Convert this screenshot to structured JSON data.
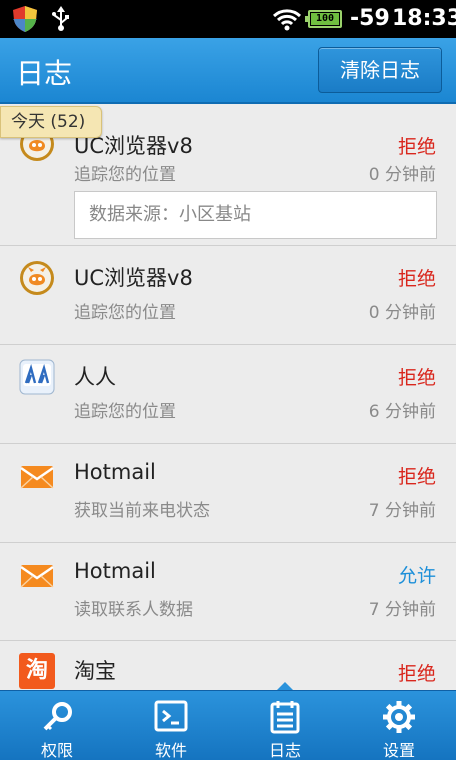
{
  "status_bar": {
    "signal": "-59",
    "time": "18:33",
    "battery_label": "100"
  },
  "header": {
    "title": "日志",
    "clear_button": "清除日志"
  },
  "day_group": {
    "label": "今天 (52)"
  },
  "entries": [
    {
      "app": "UC浏览器v8",
      "icon": "uc-browser-icon",
      "action": "拒绝",
      "action_type": "deny",
      "permission": "追踪您的位置",
      "time_ago": "0 分钟前",
      "detail": "数据来源：小区基站"
    },
    {
      "app": "UC浏览器v8",
      "icon": "uc-browser-icon",
      "action": "拒绝",
      "action_type": "deny",
      "permission": "追踪您的位置",
      "time_ago": "0 分钟前"
    },
    {
      "app": "人人",
      "icon": "renren-icon",
      "action": "拒绝",
      "action_type": "deny",
      "permission": "追踪您的位置",
      "time_ago": "6 分钟前"
    },
    {
      "app": "Hotmail",
      "icon": "hotmail-icon",
      "action": "拒绝",
      "action_type": "deny",
      "permission": "获取当前来电状态",
      "time_ago": "7 分钟前"
    },
    {
      "app": "Hotmail",
      "icon": "hotmail-icon",
      "action": "允许",
      "action_type": "allow",
      "permission": "读取联系人数据",
      "time_ago": "7 分钟前"
    },
    {
      "app": "淘宝",
      "icon": "taobao-icon",
      "icon_text": "淘",
      "action": "拒绝",
      "action_type": "deny"
    }
  ],
  "bottom_nav": [
    {
      "label": "权限",
      "icon": "key-icon"
    },
    {
      "label": "软件",
      "icon": "terminal-icon"
    },
    {
      "label": "日志",
      "icon": "log-icon",
      "active": true
    },
    {
      "label": "设置",
      "icon": "gear-icon"
    }
  ],
  "colors": {
    "deny": "#d9261c",
    "allow": "#1c8fd9",
    "title_bar": "#2a94dc",
    "nav_bar": "#1b80cc"
  }
}
